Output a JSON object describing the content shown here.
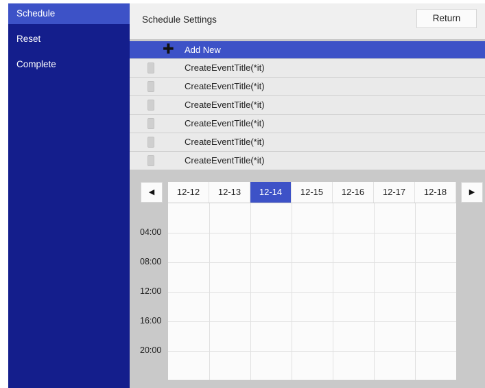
{
  "sidebar": {
    "items": [
      {
        "label": "Schedule",
        "active": true
      },
      {
        "label": "Reset",
        "active": false
      },
      {
        "label": "Complete",
        "active": false
      }
    ]
  },
  "header": {
    "title": "Schedule Settings",
    "return_label": "Return"
  },
  "list": {
    "add_new_label": "Add New",
    "events": [
      "CreateEventTitle(*it)",
      "CreateEventTitle(*it)",
      "CreateEventTitle(*it)",
      "CreateEventTitle(*it)",
      "CreateEventTitle(*it)",
      "CreateEventTitle(*it)"
    ]
  },
  "calendar": {
    "prev_label": "◀",
    "next_label": "▶",
    "days": [
      "12-12",
      "12-13",
      "12-14",
      "12-15",
      "12-16",
      "12-17",
      "12-18"
    ],
    "selected_day": "12-14",
    "times": [
      "04:00",
      "08:00",
      "12:00",
      "16:00",
      "20:00"
    ]
  },
  "colors": {
    "sidebar_bg": "#141e8c",
    "accent": "#3d52c7",
    "panel_bg": "#c9c9c9"
  }
}
